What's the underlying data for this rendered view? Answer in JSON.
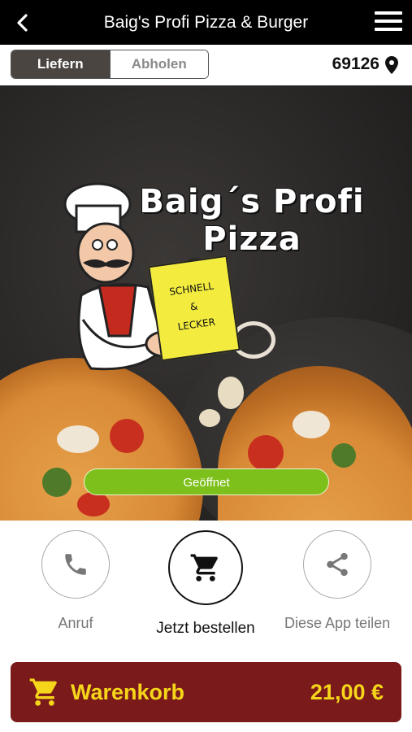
{
  "header": {
    "title": "Baig's Profi Pizza & Burger",
    "back_icon": "chevron-left-icon",
    "menu_icon": "hamburger-menu-icon"
  },
  "delivery": {
    "option_active": "Liefern",
    "option_inactive": "Abholen",
    "postal_code": "69126",
    "location_icon": "map-pin-icon"
  },
  "hero": {
    "logo_line1": "Baig´s Profi",
    "logo_line2": "Pizza",
    "note_line1": "SCHNELL",
    "note_line2": "&",
    "note_line3": "LECKER",
    "status": "Geöffnet",
    "status_color": "#7ec01b"
  },
  "actions": [
    {
      "label": "Anruf",
      "icon": "phone-icon"
    },
    {
      "label": "Jetzt bestellen",
      "icon": "cart-icon"
    },
    {
      "label": "Diese App teilen",
      "icon": "share-icon"
    }
  ],
  "cart": {
    "label": "Warenkorb",
    "total": "21,00 €",
    "icon": "cart-icon",
    "background": "#7a1a1a",
    "text_color": "#f6d61a"
  }
}
